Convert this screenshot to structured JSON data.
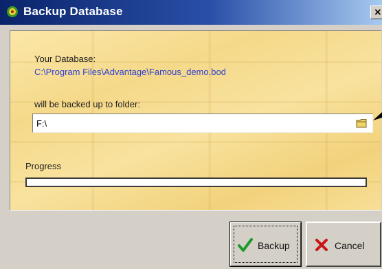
{
  "window": {
    "title": "Backup Database",
    "close_glyph": "×"
  },
  "panel": {
    "database_label": "Your Database:",
    "database_path": "C:\\Program Files\\Advantage\\Famous_demo.bod",
    "folder_label": "will be backed up to folder:",
    "folder_value": "F:\\",
    "progress_label": "Progress",
    "progress_fraction": 0
  },
  "buttons": {
    "backup_label": "Backup",
    "cancel_label": "Cancel"
  },
  "icons": {
    "app": "app-icon",
    "folder_browse": "folder-icon",
    "backup": "checkmark-icon",
    "cancel": "cross-icon"
  },
  "colors": {
    "title_bar": "#0a246a",
    "path_text": "#2c3fd0",
    "panel_wood": "#f5d98a",
    "check_green": "#1f9a2a",
    "cancel_red": "#c81414"
  }
}
